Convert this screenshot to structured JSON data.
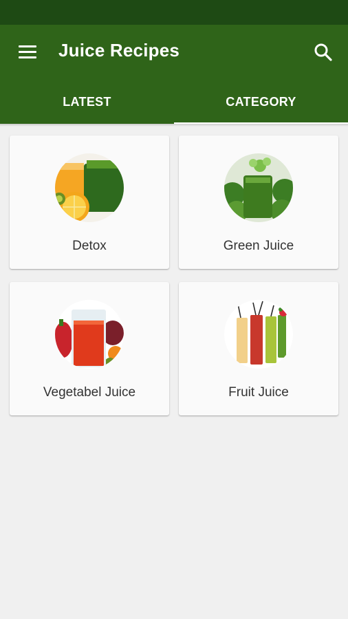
{
  "app": {
    "title": "Juice Recipes",
    "accent_color": "#2f6419",
    "status_bar_color": "#1e4a14"
  },
  "toolbar": {
    "menu_icon": "hamburger-menu-icon",
    "search_icon": "search-icon"
  },
  "tabs": [
    {
      "label": "LATEST",
      "selected": false
    },
    {
      "label": "CATEGORY",
      "selected": true
    }
  ],
  "categories": [
    {
      "label": "Detox",
      "image": "detox-juice-photo"
    },
    {
      "label": "Green Juice",
      "image": "green-juice-photo"
    },
    {
      "label": "Vegetabel Juice",
      "image": "vegetable-juice-photo"
    },
    {
      "label": "Fruit Juice",
      "image": "fruit-juice-photo"
    }
  ]
}
